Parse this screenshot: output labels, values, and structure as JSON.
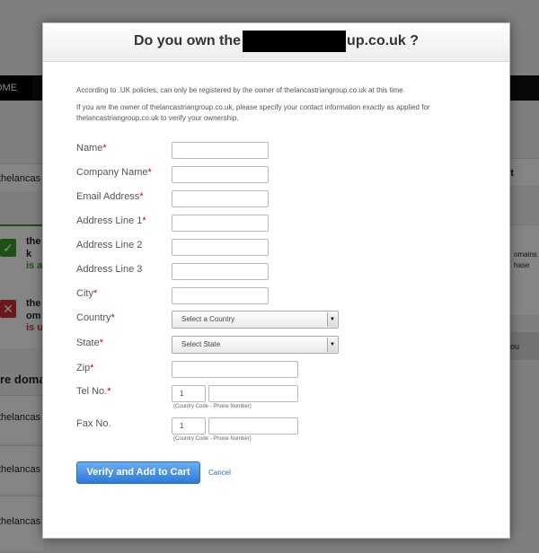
{
  "background": {
    "nav_home": "OME",
    "left_texts": [
      "thelancas",
      "the",
      "k",
      "is a",
      "the",
      "om",
      "is u",
      "re doma",
      "thelancas",
      "thelancas",
      "thelancas"
    ],
    "right_texts": [
      "rt",
      "omains",
      "hase",
      "ou"
    ]
  },
  "modal": {
    "title_prefix": "Do you own the",
    "title_suffix": "up.co.uk ?",
    "intro_line1": "According to .UK policies, can only be registered by the owner of thelancastriangroup.co.uk at this time.",
    "intro_line2": "If you are the owner of thelancastriangroup.co.uk, please specify your contact information exactly as applied for thelancastriangroup.co.uk to verify your ownership.",
    "fields": {
      "name": "Name",
      "company": "Company Name",
      "email": "Email Address",
      "address1": "Address Line 1",
      "address2": "Address Line 2",
      "address3": "Address Line 3",
      "city": "City",
      "country": "Country",
      "state": "State",
      "zip": "Zip",
      "tel": "Tel No.",
      "fax": "Fax No."
    },
    "required_mark": "*",
    "country_select": "Select a Country",
    "state_select": "State",
    "state_select_full": "Select State",
    "tel_cc": "1",
    "fax_cc": "1",
    "phone_hint": "(Country Code - Phone Number)",
    "verify_button": "Verify and Add to Cart",
    "cancel_link": "Cancel"
  },
  "colors": {
    "accent": "#2d7ad8",
    "required": "#d40000",
    "check_green": "#3a9a2a",
    "cross_red": "#c93030"
  },
  "icons": {
    "check": "check-icon",
    "cross": "cross-icon",
    "dropdown": "chevron-down-icon"
  }
}
